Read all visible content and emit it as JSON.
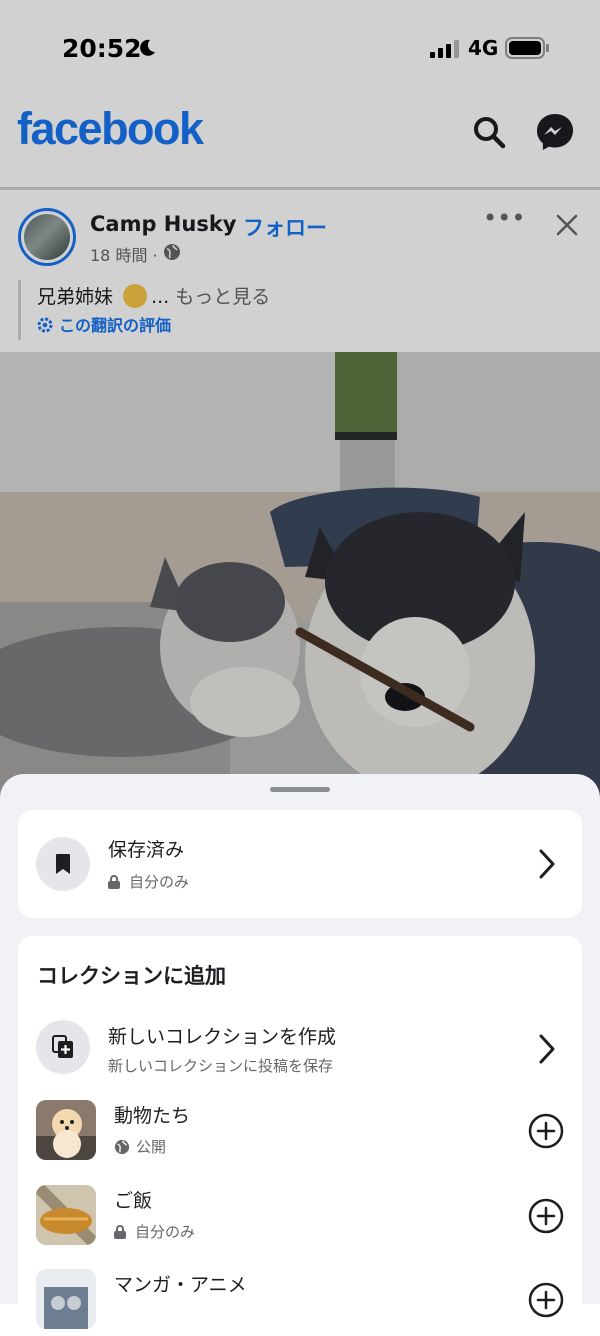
{
  "status_bar": {
    "time": "20:52",
    "network": "4G"
  },
  "header": {
    "logo": "facebook",
    "icons": [
      "search-icon",
      "messenger-icon"
    ]
  },
  "post": {
    "author": "Camp Husky",
    "separator": "·",
    "follow_label": "フォロー",
    "time": "18 時間 ·",
    "caption": "兄弟姉妹",
    "ellipsis": "...",
    "see_more": "もっと見る",
    "translation_rating": "この翻訳の評価"
  },
  "sheet": {
    "saved": {
      "title": "保存済み",
      "privacy": "自分のみ"
    },
    "collections_title": "コレクションに追加",
    "create": {
      "title": "新しいコレクションを作成",
      "subtitle": "新しいコレクションに投稿を保存"
    },
    "collections": [
      {
        "name": "動物たち",
        "privacy": "公開"
      },
      {
        "name": "ご飯",
        "privacy": "自分のみ"
      },
      {
        "name": "マンガ・アニメ"
      }
    ]
  },
  "colors": {
    "brand": "#1877f2",
    "text": "#1c1e21",
    "secondary": "#65676b",
    "sheet_bg": "#f0f2f5"
  }
}
